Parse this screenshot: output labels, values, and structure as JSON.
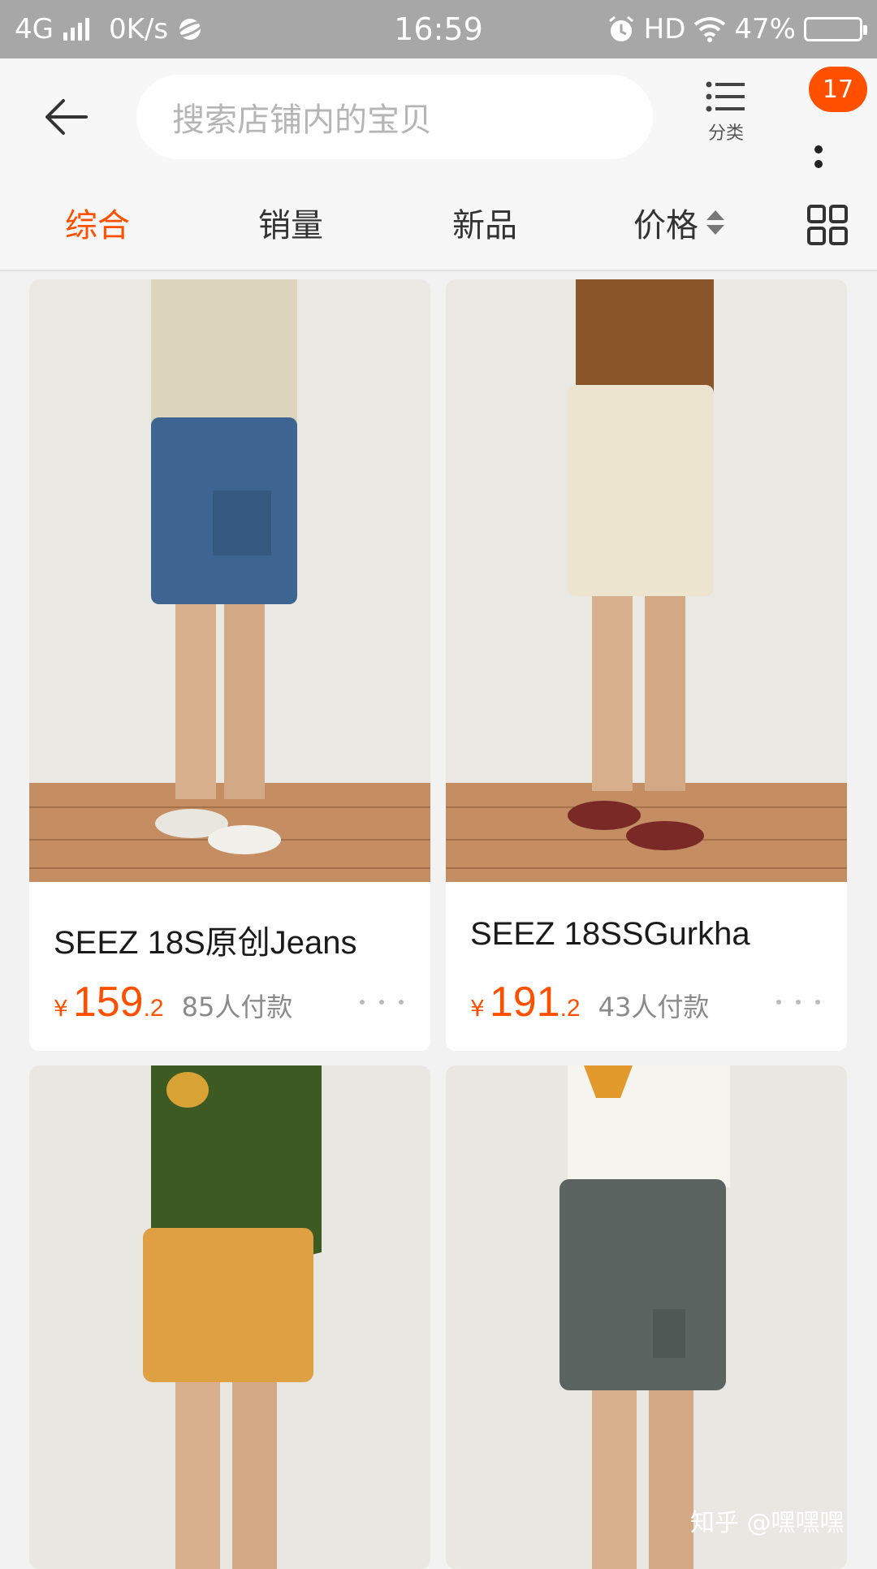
{
  "status_bar": {
    "network": "4G",
    "speed": "0K/s",
    "time": "16:59",
    "hd": "HD",
    "battery": "47%"
  },
  "header": {
    "search_placeholder": "搜索店铺内的宝贝",
    "category_label": "分类",
    "badge_count": "17"
  },
  "filters": {
    "tabs": [
      {
        "label": "综合"
      },
      {
        "label": "销量"
      },
      {
        "label": "新品"
      },
      {
        "label": "价格"
      }
    ]
  },
  "products": [
    {
      "title": "SEEZ 18S原创Jeans",
      "currency": "¥",
      "price_int": "159",
      "price_dec": ".2",
      "sales": "85人付款"
    },
    {
      "title": "SEEZ 18SSGurkha",
      "currency": "¥",
      "price_int": "191",
      "price_dec": ".2",
      "sales": "43人付款"
    },
    {
      "title": "",
      "currency": "",
      "price_int": "",
      "price_dec": "",
      "sales": ""
    },
    {
      "title": "",
      "currency": "",
      "price_int": "",
      "price_dec": "",
      "sales": ""
    }
  ],
  "watermark": "知乎 @嘿嘿嘿",
  "colors": {
    "accent": "#ff5000",
    "status_bar": "#a7a7a7"
  }
}
